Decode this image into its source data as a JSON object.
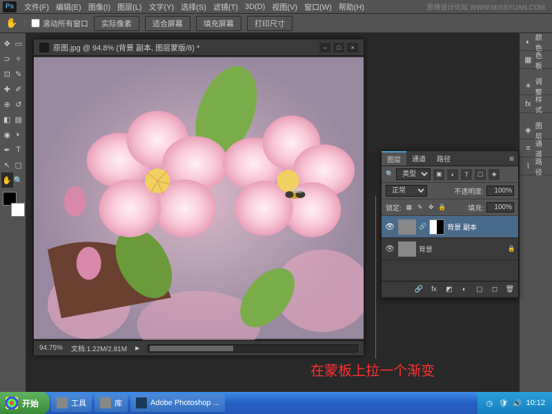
{
  "app": {
    "logo": "Ps"
  },
  "menu": [
    "文件(F)",
    "编辑(E)",
    "图像(I)",
    "图层(L)",
    "文字(Y)",
    "选择(S)",
    "滤镜(T)",
    "3D(D)",
    "视图(V)",
    "窗口(W)",
    "帮助(H)"
  ],
  "watermark": "思缘设计论坛  WWW.MISSYUAN.COM",
  "optbar": {
    "scroll_all": "滚动所有窗口",
    "actual": "实际像素",
    "fit": "适合屏幕",
    "fill": "填充屏幕",
    "print": "打印尺寸"
  },
  "doc": {
    "title": "原图.jpg @ 94.8% (背景 副本, 图层蒙版/8) *",
    "zoom": "94.75%",
    "filesize": "文档:1.22M/2.81M"
  },
  "rail": [
    {
      "label": "颜色",
      "ico": "◐"
    },
    {
      "label": "色板",
      "ico": "▦"
    },
    {
      "label": "调整",
      "ico": "☀"
    },
    {
      "label": "样式",
      "ico": "fx"
    },
    {
      "label": "图层",
      "ico": "◈"
    },
    {
      "label": "通道",
      "ico": "≡"
    },
    {
      "label": "路径",
      "ico": "⌇"
    }
  ],
  "layers": {
    "tabs": [
      "图层",
      "通道",
      "路径"
    ],
    "kind": "类型",
    "blend": "正常",
    "opacity_lbl": "不透明度:",
    "opacity_val": "100%",
    "lock_lbl": "锁定:",
    "fill_lbl": "填充:",
    "fill_val": "100%",
    "items": [
      {
        "name": "背景 副本"
      },
      {
        "name": "背景"
      }
    ]
  },
  "annotation": "在蒙板上拉一个渐变",
  "taskbar": {
    "start": "开始",
    "items": [
      {
        "label": "工具"
      },
      {
        "label": "库"
      },
      {
        "label": "Adobe Photoshop ..."
      }
    ],
    "clock": "10:12"
  }
}
